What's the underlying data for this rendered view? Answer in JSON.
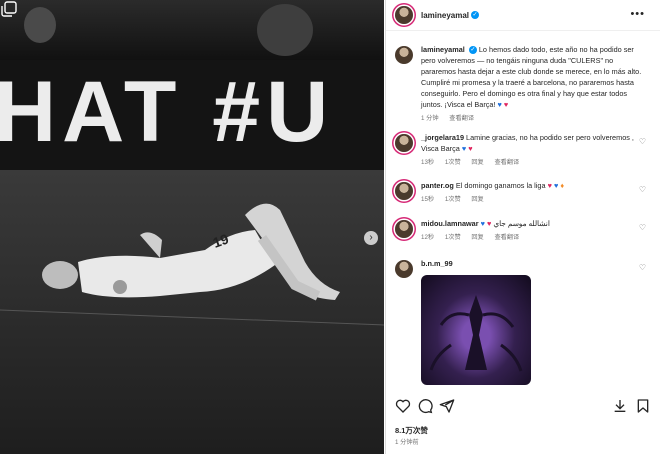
{
  "post": {
    "username": "lamineyamal",
    "caption": "Lo hemos dado todo, este año no ha podido ser pero volveremos — no tengáis ninguna duda \"CULERS\" no pararemos hasta dejar a este club donde se merece, en lo más alto. Cumpliré mi promesa y la traeré a barcelona, no pararemos hasta conseguirlo. Pero el domingo es otra final y hay que estar todos juntos. ¡Visca el Barça!",
    "caption_time": "1 分钟",
    "caption_translate": "查看翻译",
    "likes": "8.1万次赞",
    "time_ago": "1 分钟前",
    "banner_text": "HAT #U"
  },
  "comments": [
    {
      "username": "_jorgelara19",
      "text": "Lamine gracias, no ha podido ser pero volveremos , Visca Barça",
      "time": "13秒",
      "likes": "1次赞",
      "reply": "回复",
      "translate": "查看翻译"
    },
    {
      "username": "panter.og",
      "text": "El domingo ganamos la liga",
      "time": "15秒",
      "likes": "1次赞",
      "reply": "回复"
    },
    {
      "username": "midou.lamnawar",
      "text": "انشالله موسم جاي",
      "time": "12秒",
      "likes": "1次赞",
      "reply": "回复",
      "translate": "查看翻译"
    },
    {
      "username": "b.n.m_99",
      "text": ""
    }
  ],
  "icons": [
    "multi-post-icon",
    "next-arrow-icon",
    "more-icon",
    "heart-icon",
    "comment-icon",
    "share-icon",
    "save-icon",
    "verified-icon"
  ]
}
